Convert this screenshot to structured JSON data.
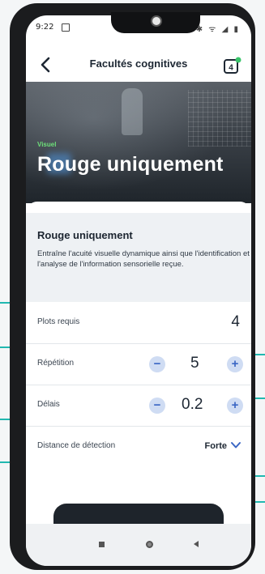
{
  "status_bar": {
    "time": "9:22",
    "right_icons": "✱ ᯤ ◢ ▮"
  },
  "header": {
    "title": "Facultés cognitives"
  },
  "hero": {
    "category": "Visuel",
    "title": "Rouge uniquement"
  },
  "description": {
    "title": "Rouge uniquement",
    "text": "Entraîne l'acuité visuelle dynamique ainsi que l'identification et l'analyse de l'information sensorielle reçue."
  },
  "settings": {
    "pods": {
      "label": "Plots requis",
      "value": "4"
    },
    "repetition": {
      "label": "Répétition",
      "value": "5",
      "minus": "−",
      "plus": "+"
    },
    "delay": {
      "label": "Délais",
      "value": "0.2",
      "minus": "−",
      "plus": "+"
    },
    "detection": {
      "label": "Distance de détection",
      "value": "Forte"
    }
  },
  "colors": {
    "accent_blue": "#3a66c4",
    "category_green": "#6ee07a",
    "dark": "#1e242b",
    "annotation_teal": "#21b8b0"
  }
}
